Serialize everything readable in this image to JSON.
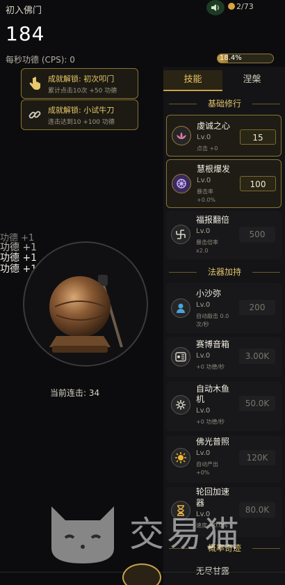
{
  "app": {
    "title": "初入佛门"
  },
  "status": {
    "achievements": "2/73",
    "merit": "184",
    "cps": "每秒功德 (CPS): 0",
    "progress_text": "18.4%",
    "progress": 0.184
  },
  "toasts": [
    {
      "title": "成就解锁: 初次叩门",
      "desc": "累计点击10次 +50 功德"
    },
    {
      "title": "成就解锁: 小试牛刀",
      "desc": "连击达到10 +100 功德"
    }
  ],
  "floats": [
    "功德 +1",
    "功德 +1",
    "功德 +1",
    "功德 +1"
  ],
  "combo": "当前连击: 34",
  "tabs": [
    "技能",
    "涅槃"
  ],
  "sections": {
    "basic": "基础修行",
    "tools": "法器加持",
    "prob": "概率奇迹"
  },
  "skills": [
    {
      "name": "虔诚之心",
      "lv": "Lv.0",
      "desc": "点击 +0",
      "cost": "15"
    },
    {
      "name": "慧根爆发",
      "lv": "Lv.0",
      "desc": "暴击率",
      "desc2": "+0.0%",
      "cost": "100"
    },
    {
      "name": "福报翻倍",
      "lv": "Lv.0",
      "desc": "暴击倍率",
      "desc2": "x2.0",
      "cost": "500"
    }
  ],
  "tools": [
    {
      "name": "小沙弥",
      "lv": "Lv.0",
      "desc": "自动敲击 0.0",
      "desc2": "次/秒",
      "cost": "200"
    },
    {
      "name": "赛博音箱",
      "lv": "Lv.0",
      "desc": "+0 功德/秒",
      "cost": "3.00K"
    },
    {
      "name": "自动木鱼",
      "name2": "机",
      "lv": "Lv.0",
      "desc": "+0 功德/秒",
      "cost": "50.0K"
    },
    {
      "name": "佛光普照",
      "lv": "Lv.0",
      "desc": "自动产出",
      "desc2": "+0%",
      "cost": "120K"
    },
    {
      "name": "轮回加速",
      "name2": "器",
      "lv": "Lv.0",
      "desc": "速度 +0.0%",
      "cost": "80.0K"
    }
  ],
  "partial_item": "无尽甘露",
  "watermark": "交易猫"
}
